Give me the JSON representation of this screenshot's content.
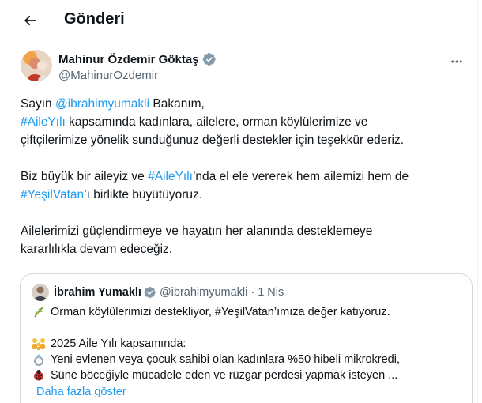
{
  "header": {
    "back_icon": "arrow-left-icon",
    "title": "Gönderi"
  },
  "post": {
    "author": {
      "display_name": "Mahinur Özdemir Göktaş",
      "handle": "@MahinurOzdemir",
      "verified": true
    },
    "more_icon": "more-horizontal-icon",
    "text": {
      "p1_prefix": "Sayın ",
      "p1_mention": "@ibrahimyumakli",
      "p1_suffix": " Bakanım,",
      "p2_hashtag": "#AileYılı",
      "p2_rest": " kapsamında kadınlara, ailelere, orman köylülerimize ve",
      "p2_line2": "çiftçilerimize yönelik sunduğunuz değerli destekler için teşekkür ederiz.",
      "p3_prefix": "Biz büyük bir aileyiz ve ",
      "p3_hashtag": "#AileYılı",
      "p3_mid": "’nda el ele vererek hem ailemizi hem de",
      "p3_hashtag2": "#YeşilVatan",
      "p3_suffix": "’ı birlikte büyütüyoruz.",
      "p4_line1": "Ailelerimizi güçlendirmeye ve hayatın her alanında desteklemeye",
      "p4_line2": "kararlılıkla devam edeceğiz."
    }
  },
  "quote": {
    "name": "İbrahim Yumaklı",
    "handle": "@ibrahimyumakli",
    "separator": "·",
    "time": "1 Nis",
    "verified": true,
    "line1": "Orman köylülerimizi destekliyor, #YeşilVatan’ımıza değer katıyoruz.",
    "line2": "2025 Aile Yılı kapsamında:",
    "line3": "Yeni evlenen veya çocuk sahibi olan kadınlara %50 hibeli mikrokredi,",
    "line4": "Süne böceğiyle mücadele eden ve rüzgar perdesi yapmak isteyen ...",
    "show_more": "Daha fazla göster",
    "emojis": [
      "sprout-emoji",
      "family-emoji",
      "ring-emoji",
      "ladybug-emoji"
    ]
  },
  "colors": {
    "link": "#1d9bf0",
    "text": "#0f1419",
    "secondary": "#536471",
    "border": "#cfd9de"
  }
}
